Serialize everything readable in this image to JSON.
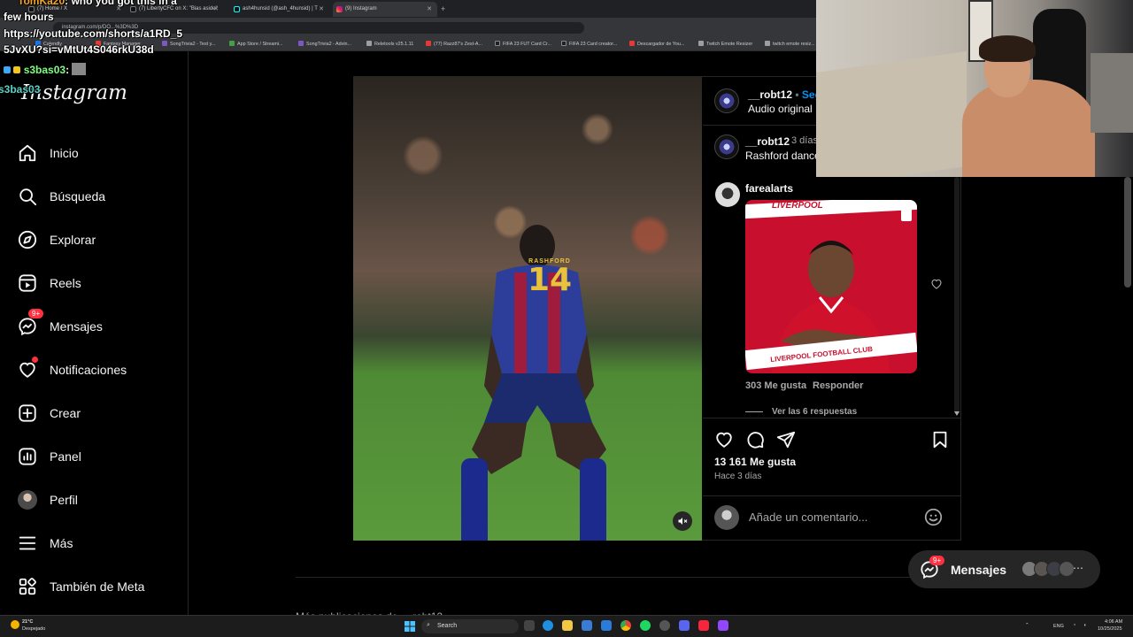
{
  "browser": {
    "tabs": [
      {
        "label": "(7) Home / X"
      },
      {
        "label": "(7) LibertyCFC on X: \"Bias aside\""
      },
      {
        "label": "ash4hunsid (@ash_4hunsid) | T"
      },
      {
        "label": "(9) Instagram"
      }
    ],
    "url": "instagram.com/p/DO...%3D%3D",
    "bookmarks": [
      "Calendly",
      "Fantasy Manager",
      "SongTrivia2 - Test y...",
      "App Store / Streami...",
      "SongTrivia2 - Advin...",
      "Reletools v25.1.11",
      "(77) Razz87's Zest-A...",
      "FIFA 23 FUT Card Cr...",
      "FIFA 23 Card creator...",
      "Descargador de You...",
      "Twitch Emote Resizer",
      "twitch emote resiz..."
    ]
  },
  "stream_overlay": {
    "chat1_user": "TomKa20",
    "chat1_text": ": who you got this in a",
    "chat1_cont": "few hours",
    "link1": "https://youtube.com/shorts/a1RD_5",
    "link2": "5JvXU?si=vMtUt4S046rkU38d",
    "chat2_user": "s3bas03",
    "chat2_text": ":",
    "chat3_user": "s3bas03"
  },
  "sidebar": {
    "logo": "Instagram",
    "items": [
      {
        "label": "Inicio",
        "icon": "home-icon"
      },
      {
        "label": "Búsqueda",
        "icon": "search-icon"
      },
      {
        "label": "Explorar",
        "icon": "compass-icon"
      },
      {
        "label": "Reels",
        "icon": "reels-icon"
      },
      {
        "label": "Mensajes",
        "icon": "messenger-icon",
        "badge": "9+"
      },
      {
        "label": "Notificaciones",
        "icon": "heart-icon"
      },
      {
        "label": "Crear",
        "icon": "plus-square-icon"
      },
      {
        "label": "Panel",
        "icon": "chart-icon"
      },
      {
        "label": "Perfil",
        "icon": "avatar"
      },
      {
        "label": "Más",
        "icon": "menu-icon"
      },
      {
        "label": "También de Meta",
        "icon": "meta-grid-icon"
      }
    ]
  },
  "post": {
    "author": "__robt12",
    "follow": "Seg",
    "audio": "Audio original",
    "jersey_name": "RASHFORD",
    "jersey_number": "14",
    "caption_user": "__robt12",
    "caption_time": "3 días",
    "caption_text": "Rashford dance",
    "comment": {
      "user": "farealarts",
      "gif_club": "LIVERPOOL",
      "gif_banner": "LIVERPOOL FOOTBALL CLUB",
      "likes": "303 Me gusta",
      "reply": "Responder",
      "view_replies": "Ver las 6 respuestas"
    },
    "likes": "13 161 Me gusta",
    "posted": "Hace 3 días",
    "comment_placeholder": "Añade un comentario..."
  },
  "more_from": "Más publicaciones de __robt12",
  "messages_pill": {
    "label": "Mensajes",
    "badge": "9+"
  },
  "taskbar": {
    "temp": "21°C",
    "weather": "Despejado",
    "search": "Search",
    "lang": "ENG",
    "time": "4:06 AM",
    "date": "10/25/2025"
  },
  "colors": {
    "accent_red": "#ff3040",
    "background": "#000000",
    "liverpool_red": "#c8102e"
  }
}
